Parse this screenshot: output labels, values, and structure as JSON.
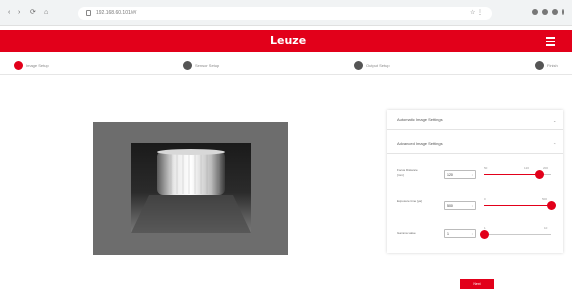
{
  "browser": {
    "url": "192.168.60.101/#/",
    "url_right": "☆ ⋮",
    "nav": {
      "back": "‹",
      "forward": "›",
      "reload": "⟳",
      "home": "⌂"
    }
  },
  "app": {
    "logo": "Leuze",
    "brand_color": "#e2001a"
  },
  "stepper": {
    "steps": [
      {
        "label": "Image Setup",
        "active": true
      },
      {
        "label": "Sensor Setup",
        "active": false
      },
      {
        "label": "Output Setup",
        "active": false
      },
      {
        "label": "Finish",
        "active": false
      }
    ]
  },
  "panel": {
    "section1_title": "Automatic Image Settings",
    "section2_title": "Advanced Image Settings",
    "rows": [
      {
        "label": "Focus Distance [mm]",
        "value": "120",
        "ticks": [
          "50",
          "120",
          "200"
        ],
        "level": 0.82
      },
      {
        "label": "Exposure time [µs]",
        "value": "500",
        "ticks": [
          "0",
          "500"
        ],
        "level": 1.0
      },
      {
        "label": "Gamma value",
        "value": "1",
        "ticks": [
          "1",
          "10"
        ],
        "level": 0.0
      }
    ]
  },
  "footer": {
    "next_label": "Next"
  }
}
